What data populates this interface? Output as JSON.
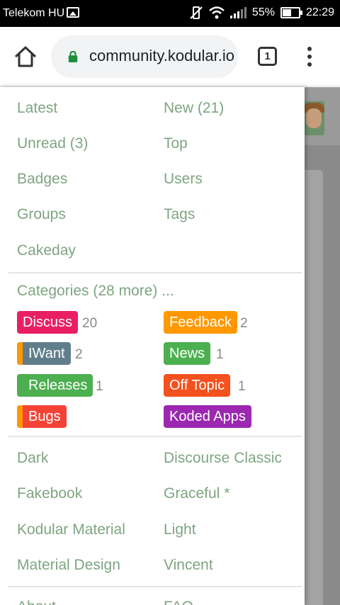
{
  "status_bar": {
    "carrier": "Telekom HU",
    "battery": "55%",
    "battery_level": 0.55,
    "time": "22:29"
  },
  "browser": {
    "url": "community.kodular.io",
    "tab_count": "1"
  },
  "menu": {
    "nav_left": [
      "Latest",
      "Unread (3)",
      "Badges",
      "Groups",
      "Cakeday"
    ],
    "nav_right": [
      "New (21)",
      "Top",
      "Users",
      "Tags"
    ],
    "categories_title": "Categories (28 more) ...",
    "categories": [
      {
        "name": "Discuss",
        "count": "20",
        "color": "#e91e63",
        "stripe": ""
      },
      {
        "name": "Feedback",
        "count": "2",
        "color": "#ff9800",
        "stripe": ""
      },
      {
        "name": "IWant",
        "count": "2",
        "color": "#607d8b",
        "stripe": "#ff9800"
      },
      {
        "name": "News",
        "count": "1",
        "color": "#4caf50",
        "stripe": ""
      },
      {
        "name": "Releases",
        "count": "1",
        "color": "#4caf50",
        "stripe": "#4caf50"
      },
      {
        "name": "Off Topic",
        "count": "1",
        "color": "#f4511e",
        "stripe": ""
      },
      {
        "name": "Bugs",
        "count": "",
        "color": "#f44336",
        "stripe": "#ff9800"
      },
      {
        "name": "Koded Apps",
        "count": "",
        "color": "#9c27b0",
        "stripe": ""
      }
    ],
    "themes_left": [
      "Dark",
      "Fakebook",
      "Kodular Material",
      "Material Design"
    ],
    "themes_right": [
      "Discourse Classic",
      "Graceful *",
      "Light",
      "Vincent"
    ],
    "footer_left": "About",
    "footer_right": "FAQ"
  },
  "colors": {
    "link": "#7ea580",
    "lock": "#1e8e3e"
  }
}
